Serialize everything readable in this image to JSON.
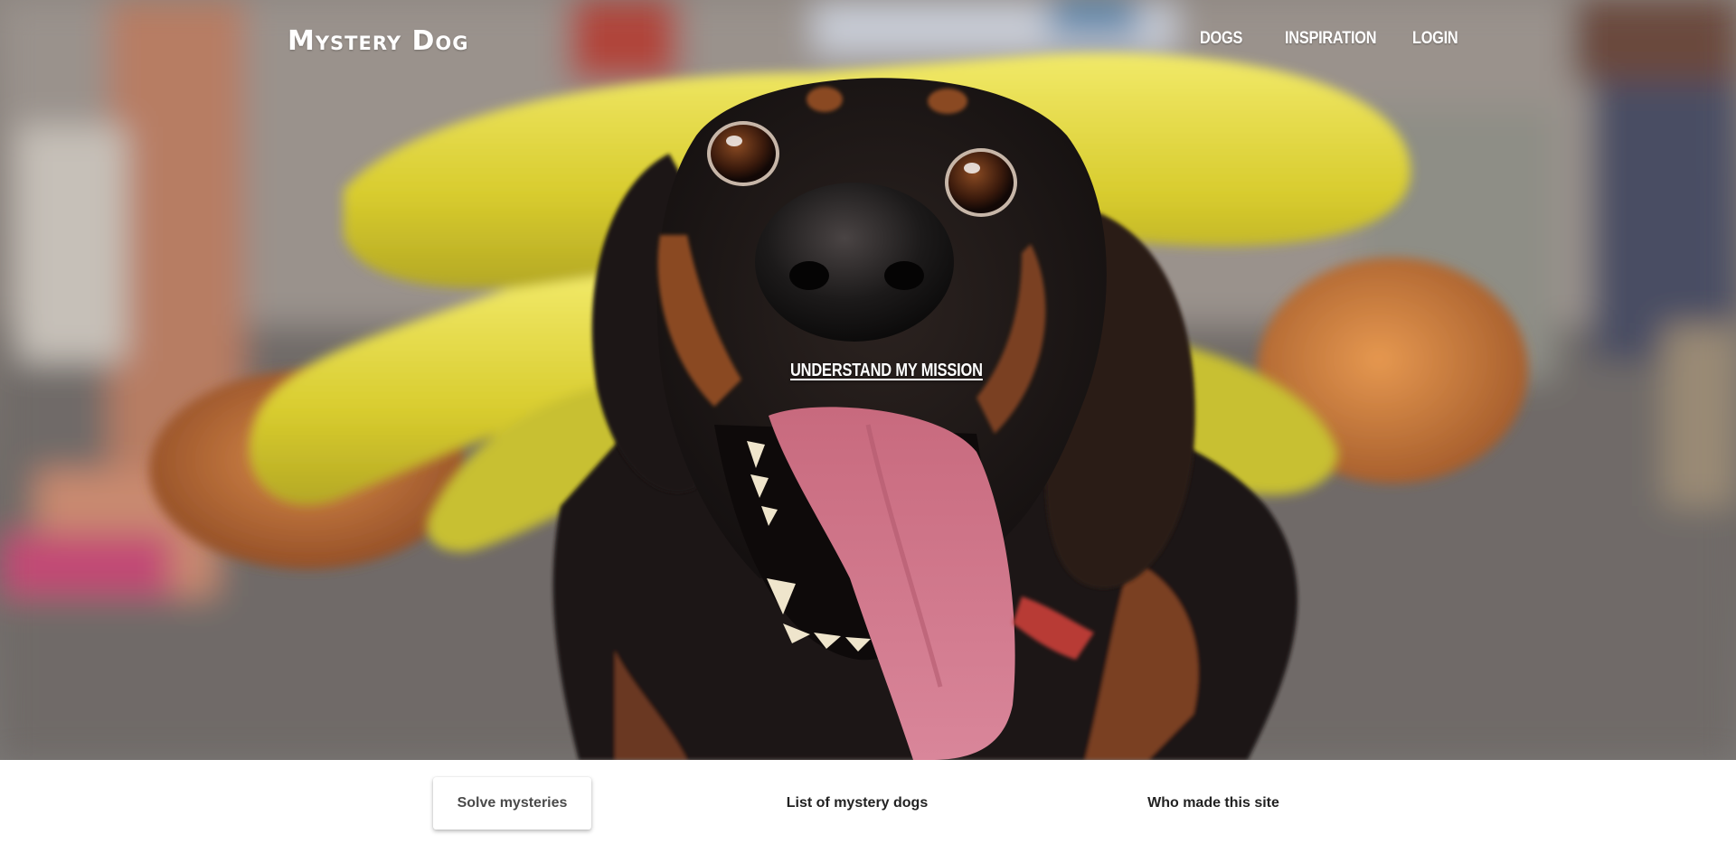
{
  "header": {
    "logo": "Mystery Dog",
    "nav": [
      "DOGS",
      "INSPIRATION",
      "LOGIN"
    ]
  },
  "hero": {
    "image": "dachshund-in-hot-dog-costume",
    "cta": "UNDERSTAND MY MISSION"
  },
  "tabs": {
    "items": [
      "Solve mysteries",
      "List of mystery dogs",
      "Who made this site"
    ],
    "active": "Solve mysteries"
  }
}
